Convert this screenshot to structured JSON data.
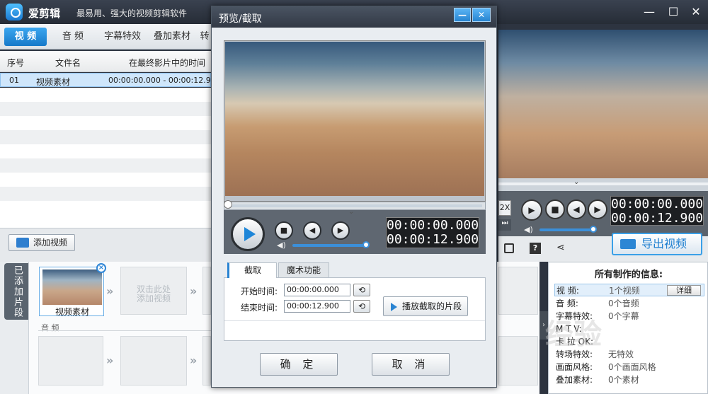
{
  "app": {
    "name": "爱剪辑",
    "slogan": "最易用、强大的视频剪辑软件"
  },
  "window_controls": [
    "minimize-icon",
    "maximize-icon",
    "close-icon"
  ],
  "left_tabs": [
    "视 频",
    "音 频",
    "字幕特效",
    "叠加素材",
    "转"
  ],
  "list": {
    "headers": [
      "序号",
      "文件名",
      "在最终影片中的时间"
    ],
    "rows": [
      {
        "index": "01",
        "name": "视频素材",
        "time": "00:00:00.000 - 00:00:12.9"
      }
    ]
  },
  "add_video_label": "添加视频",
  "timeline": {
    "side_tab": "已添加片段",
    "clip_label": "视频素材",
    "placeholder": "双击此处\n添加视频",
    "audio_label": "音 频"
  },
  "dialog": {
    "title": "预览/截取",
    "time_display": [
      "00:00:00.000",
      "00:00:12.900"
    ],
    "tabs": [
      "截取",
      "魔术功能"
    ],
    "start_label": "开始时间:",
    "start_value": "00:00:00.000",
    "end_label": "结束时间:",
    "end_value": "00:00:12.900",
    "play_clip_label": "播放截取的片段",
    "ok_label": "确 定",
    "cancel_label": "取 消",
    "progress": 0.0,
    "volume": 0.95
  },
  "right": {
    "speed": "2X",
    "time_display": [
      "00:00:00.000",
      "00:00:12.900"
    ],
    "export_label": "导出视频",
    "info_title": "所有制作的信息:",
    "info": [
      {
        "key": "视   频:",
        "value": "1个视频",
        "detail": "详细"
      },
      {
        "key": "音   频:",
        "value": "0个音频"
      },
      {
        "key": "字幕特效:",
        "value": "0个字幕"
      },
      {
        "key": "M  T  V:",
        "value": ""
      },
      {
        "key": "卡 拉 OK:",
        "value": ""
      },
      {
        "key": "转场特效:",
        "value": "无特效"
      },
      {
        "key": "画面风格:",
        "value": "0个画面风格"
      },
      {
        "key": "叠加素材:",
        "value": "0个素材"
      }
    ]
  },
  "watermark": "经验"
}
